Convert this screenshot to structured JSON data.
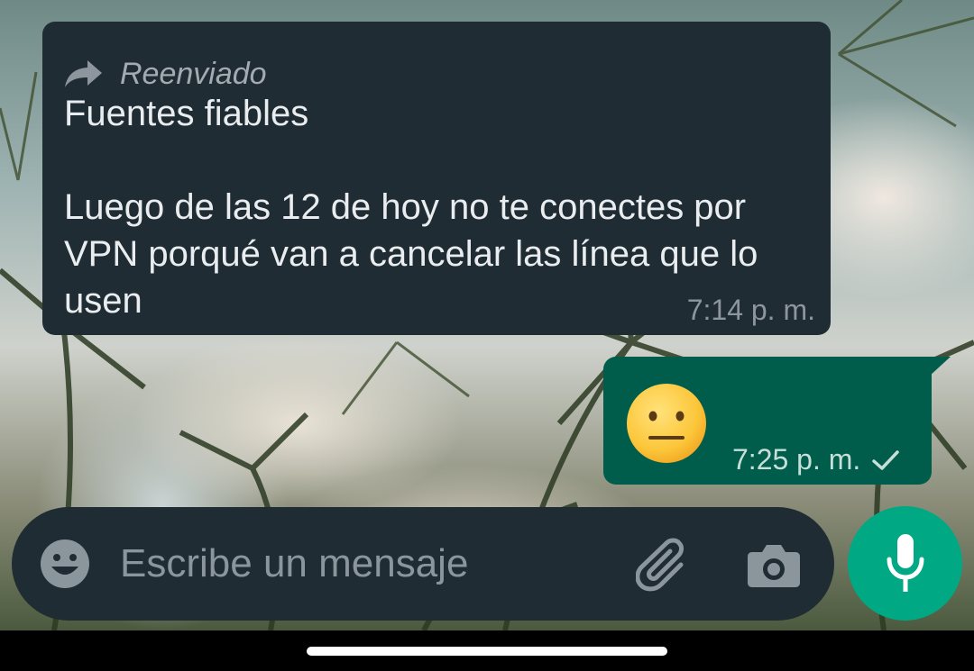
{
  "conversation": {
    "incoming_message": {
      "forwarded_label": "Reenviado",
      "title": "Fuentes fiables",
      "body": "Luego de las 12 de hoy no te conectes por VPN porqué van a cancelar las línea que lo usen",
      "time": "7:14 p. m."
    },
    "outgoing_message": {
      "emoji": "neutral-face-emoji",
      "time": "7:25 p. m.",
      "status_icon": "single-check-icon"
    }
  },
  "composer": {
    "placeholder": "Escribe un mensaje",
    "emoji_icon": "emoji-icon",
    "attach_icon": "paperclip-icon",
    "camera_icon": "camera-icon",
    "mic_icon": "microphone-icon"
  },
  "colors": {
    "incoming_bubble": "#202c33",
    "outgoing_bubble": "#005c4b",
    "input_bar": "#1f2c33",
    "mic_button": "#00a884"
  }
}
